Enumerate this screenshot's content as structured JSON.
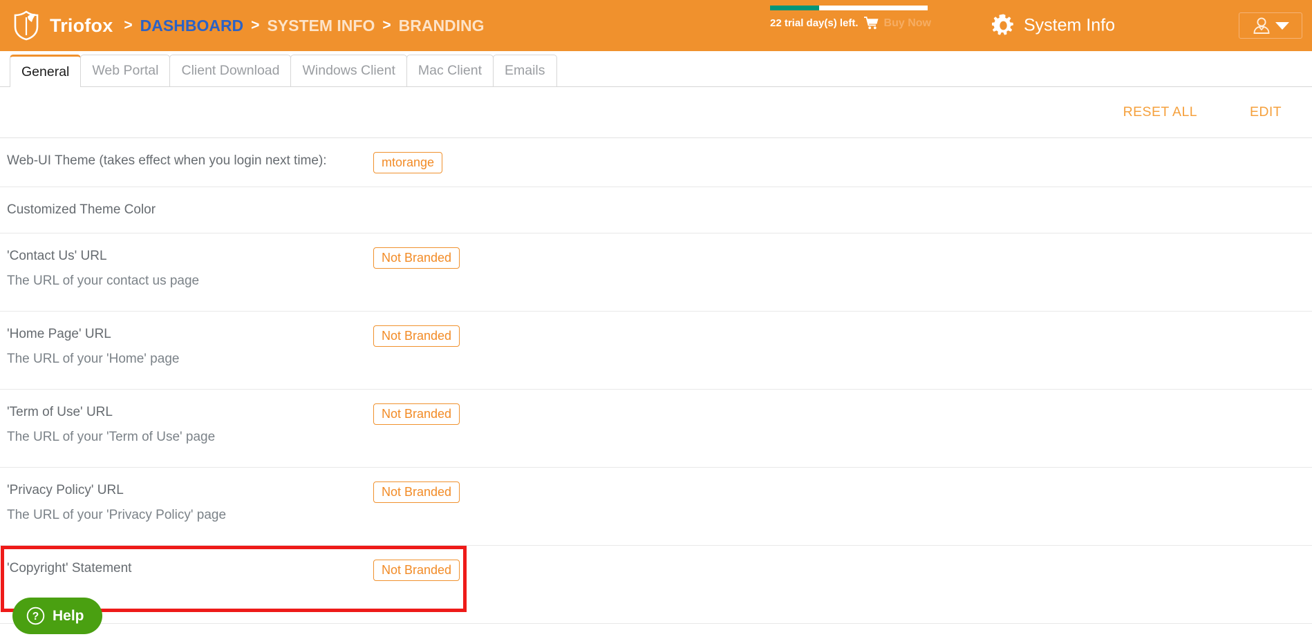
{
  "header": {
    "logo_icon": "shield-logo-icon",
    "brand": "Triofox",
    "breadcrumb": [
      {
        "sep": ">",
        "label": "DASHBOARD",
        "kind": "link"
      },
      {
        "sep": ">",
        "label": "SYSTEM INFO",
        "kind": "item"
      },
      {
        "sep": ">",
        "label": "BRANDING",
        "kind": "item"
      }
    ],
    "trial": {
      "text": "22 trial day(s) left.",
      "cart_icon": "shopping-cart-icon",
      "buy_now": "Buy Now",
      "progress_percent": 31
    },
    "system_info": {
      "gear_icon": "gear-icon",
      "label": "System Info"
    },
    "user_menu": {
      "avatar_icon": "user-avatar-icon",
      "caret_icon": "caret-down-icon"
    },
    "accent_color": "#f0912d",
    "link_color": "#2b62c6",
    "progress_color": "#029678"
  },
  "tabs": [
    {
      "label": "General",
      "active": true
    },
    {
      "label": "Web Portal",
      "active": false
    },
    {
      "label": "Client Download",
      "active": false
    },
    {
      "label": "Windows Client",
      "active": false
    },
    {
      "label": "Mac Client",
      "active": false
    },
    {
      "label": "Emails",
      "active": false
    }
  ],
  "actions": {
    "reset_all": "RESET ALL",
    "edit": "EDIT"
  },
  "settings_rows": [
    {
      "title": "Web-UI Theme (takes effect when you login next time):",
      "desc": "",
      "value": "mtorange",
      "has_value": true,
      "highlighted": false
    },
    {
      "title": "Customized Theme Color",
      "desc": "",
      "value": "",
      "has_value": false,
      "highlighted": false
    },
    {
      "title": "'Contact Us' URL",
      "desc": "The URL of your contact us page",
      "value": "Not Branded",
      "has_value": true,
      "highlighted": false
    },
    {
      "title": "'Home Page' URL",
      "desc": "The URL of your 'Home' page",
      "value": "Not Branded",
      "has_value": true,
      "highlighted": false
    },
    {
      "title": "'Term of Use' URL",
      "desc": "The URL of your 'Term of Use' page",
      "value": "Not Branded",
      "has_value": true,
      "highlighted": false
    },
    {
      "title": "'Privacy Policy' URL",
      "desc": "The URL of your 'Privacy Policy' page",
      "value": "Not Branded",
      "has_value": true,
      "highlighted": false
    },
    {
      "title": "'Copyright' Statement",
      "desc": "",
      "value": "Not Branded",
      "has_value": true,
      "highlighted": true
    }
  ],
  "help_widget": {
    "icon": "question-mark-circle-icon",
    "label": "Help",
    "color": "#4aa011"
  },
  "highlight_color": "#ee1b19",
  "badge_color": "#f28b26"
}
